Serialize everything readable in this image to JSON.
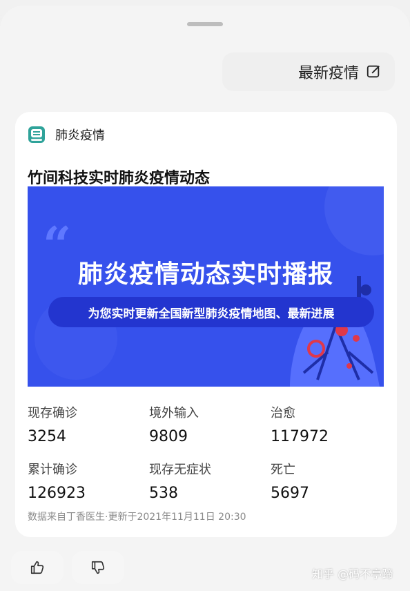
{
  "top_action": {
    "label": "最新疫情",
    "icon": "edit-icon"
  },
  "card": {
    "app_name": "肺炎疫情",
    "app_icon": "pneumonia-app-icon",
    "title": "竹间科技实时肺炎疫情动态",
    "banner": {
      "headline": "肺炎疫情动态实时播报",
      "subline": "为您实时更新全国新型肺炎疫情地图、最新进展",
      "quote_glyph": "“"
    },
    "stats": [
      {
        "label": "现存确诊",
        "value": "3254"
      },
      {
        "label": "境外输入",
        "value": "9809"
      },
      {
        "label": "治愈",
        "value": "117972"
      },
      {
        "label": "累计确诊",
        "value": "126923"
      },
      {
        "label": "现存无症状",
        "value": "538"
      },
      {
        "label": "死亡",
        "value": "5697"
      }
    ],
    "source": "数据来自丁香医生·更新于2021年11月11日 20:30"
  },
  "feedback": {
    "like_icon": "thumbs-up-icon",
    "dislike_icon": "thumbs-down-icon"
  },
  "watermark": "知乎 @码不亭蹄",
  "colors": {
    "banner": "#3651ec",
    "banner_pill": "#2335cf",
    "accent_red": "#e0384a"
  }
}
